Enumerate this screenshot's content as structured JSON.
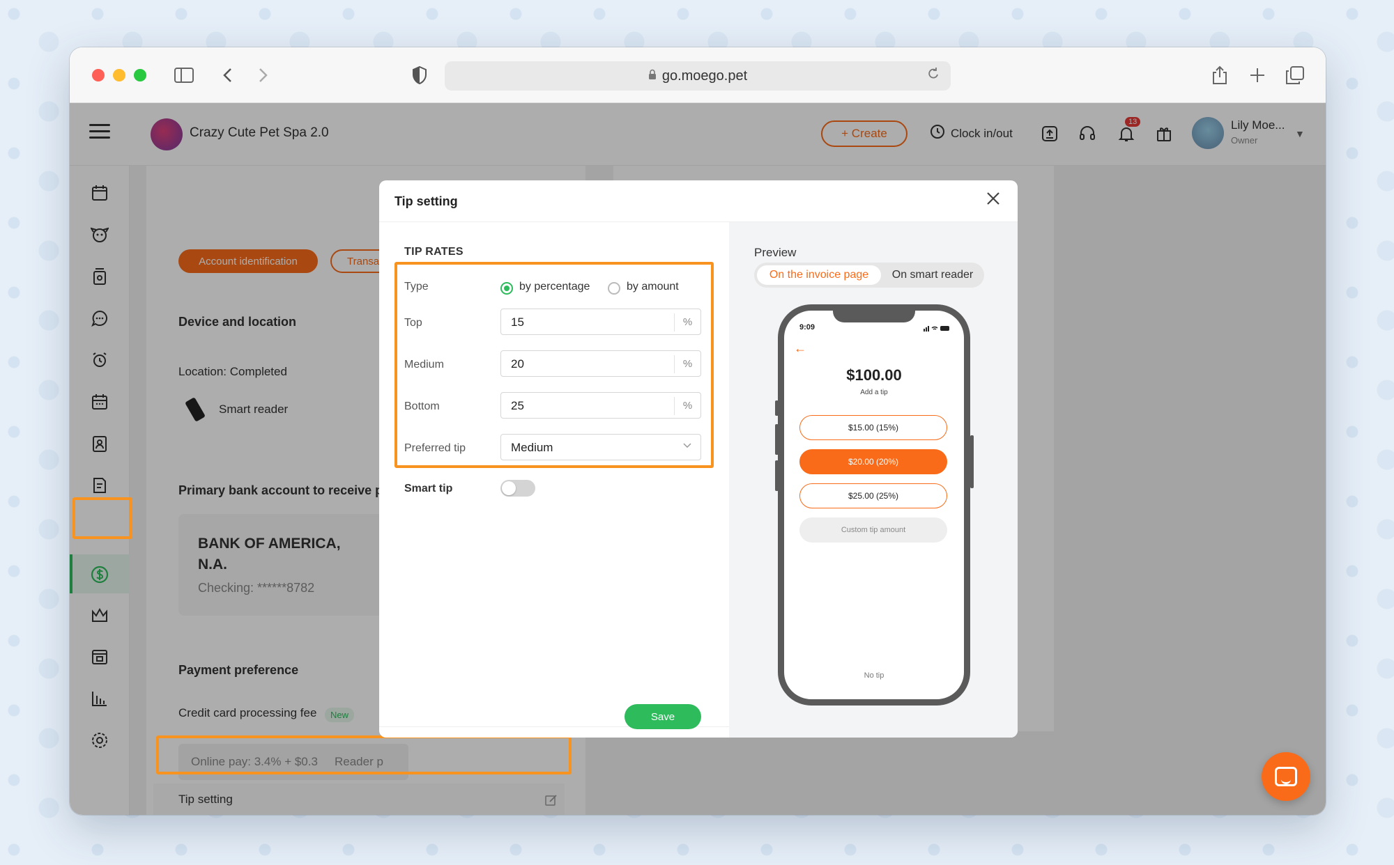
{
  "browser": {
    "url": "go.moego.pet"
  },
  "topnav": {
    "business_name": "Crazy Cute Pet Spa 2.0",
    "create_label": "+ Create",
    "clock_label": "Clock in/out",
    "notification_count": "13",
    "user_name": "Lily Moe...",
    "user_role": "Owner"
  },
  "sidebar": {
    "icons": [
      "calendar-icon",
      "pet-face-icon",
      "pet-food-icon",
      "chat-icon",
      "alarm-icon",
      "booking-calendar-icon",
      "clipboard-icon",
      "reports-doc-icon",
      "dollar-icon",
      "crown-icon",
      "schedule-icon",
      "chart-icon",
      "settings-icon"
    ],
    "active": "dollar-icon",
    "active_color": "#2dbb5c"
  },
  "page": {
    "tab_account": "Account identification",
    "tab_transactions": "Transa",
    "device_title": "Device and location",
    "location_status": "Location: Completed",
    "smart_reader": "Smart reader",
    "bank_title": "Primary bank account to receive p",
    "bank_name": "BANK OF AMERICA, N.A.",
    "bank_checking": "Checking: ******8782",
    "payment_pref_title": "Payment preference",
    "cc_fee_label": "Credit card processing fee",
    "new_tag": "New",
    "online_pay": "Online pay: 3.4% + $0.3",
    "reader_pay": "Reader p",
    "tip_setting_row": "Tip setting"
  },
  "modal": {
    "title": "Tip setting",
    "section_label": "TIP RATES",
    "type_label": "Type",
    "type_options": [
      "by percentage",
      "by amount"
    ],
    "type_selected": "by percentage",
    "top_label": "Top",
    "top_value": "15",
    "medium_label": "Medium",
    "medium_value": "20",
    "bottom_label": "Bottom",
    "bottom_value": "25",
    "percent_suffix": "%",
    "preferred_label": "Preferred tip",
    "preferred_value": "Medium",
    "smart_tip_label": "Smart tip",
    "smart_tip_on": false,
    "save_label": "Save",
    "preview_label": "Preview",
    "preview_tab_invoice": "On the invoice page",
    "preview_tab_reader": "On smart reader",
    "preview_tab_selected": "On the invoice page",
    "phone": {
      "time": "9:09",
      "amount": "$100.00",
      "subtitle": "Add a tip",
      "options": [
        "$15.00 (15%)",
        "$20.00 (20%)",
        "$25.00 (25%)"
      ],
      "selected_option": "$20.00 (20%)",
      "custom": "Custom tip amount",
      "no_tip": "No tip"
    }
  },
  "colors": {
    "accent": "#f96b18",
    "highlight": "#f7931e",
    "success": "#2dbb5c"
  }
}
